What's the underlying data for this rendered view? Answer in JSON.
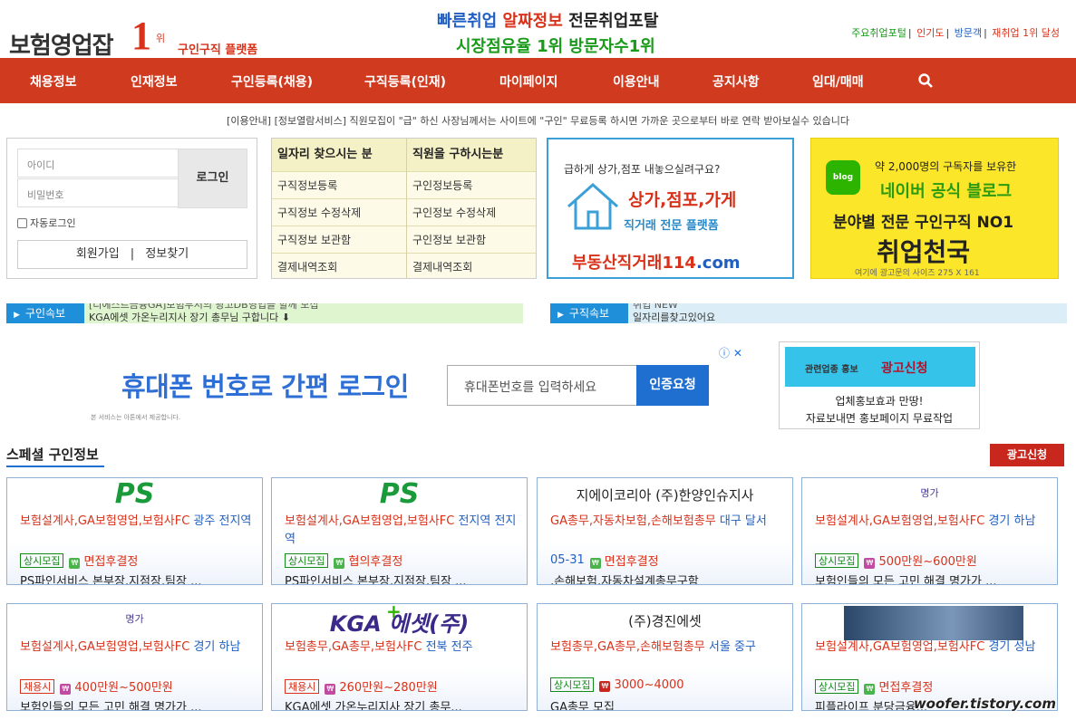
{
  "header": {
    "brand": "보험영업잡",
    "rank": "1",
    "rank_suffix": "위",
    "platform": "구인구직 플랫폼",
    "slogan_line1": [
      "빠른취업",
      "알짜정보",
      "전문취업포탈"
    ],
    "slogan_line2": "시장점유율 1위 방문자수1위",
    "top_links": [
      "주요취업포털",
      "인기도",
      "방문객",
      "재취업 1위 달성"
    ]
  },
  "nav": {
    "items": [
      "채용정보",
      "인재정보",
      "구인등록(채용)",
      "구직등록(인재)",
      "마이페이지",
      "이용안내",
      "공지사항",
      "임대/매매"
    ],
    "search_icon": "search-icon"
  },
  "notice": "[이용안내] [정보열람서비스] 직원모집이 \"급\" 하신 사장님께서는 사이트에 \"구인\" 무료등록 하시면 가까운 곳으로부터 바로 연락 받아보실수 있습니다",
  "login": {
    "id_placeholder": "아이디",
    "pw_placeholder": "비밀번호",
    "login_button": "로그인",
    "auto_login": "자동로그인",
    "join": "회원가입",
    "separator": "|",
    "find": "정보찾기"
  },
  "menu_table": {
    "headers": [
      "일자리 찾으시는 분",
      "직원을 구하시는분"
    ],
    "left": [
      "구직정보등록",
      "구직정보 수정삭제",
      "구직정보 보관함",
      "결제내역조회"
    ],
    "right": [
      "구인정보등록",
      "구인정보 수정삭제",
      "구인정보 보관함",
      "결제내역조회"
    ]
  },
  "realty_banner": {
    "question": "급하게 상가,점포 내놓으실려구요?",
    "headline": "상가,점포,가게",
    "sub": "직거래 전문 플랫폼",
    "url_main": "부동산직거래114",
    "url_tld": ".com"
  },
  "blog_banner": {
    "icon_text": "blog",
    "line1": "약 2,000명의 구독자를 보유한",
    "line2": "네이버 공식 블로그",
    "line3": "분야별 전문 구인구직 NO1",
    "line4": "취업천국",
    "line5": "여기에 광고문의 사이즈 275 X 161"
  },
  "tickers": [
    {
      "label": "구인속보",
      "lines": [
        "[디에스트금융GA]보험부서의 광고DB영업을 할께 모집",
        "KGA에셋 가온누리지사 장기 총무님 구합니다 ⬇"
      ]
    },
    {
      "label": "구직속보",
      "lines": [
        "취업 NEW",
        "일자리를찾고있어요"
      ]
    }
  ],
  "phone_login": {
    "title": "휴대폰 번호로 간편 로그인",
    "input_placeholder": "휴대폰번호를 입력하세요",
    "button": "인증요청",
    "note": "본 서비스는 아톤에서 제공합니다.",
    "close": "ⓘ ✕"
  },
  "small_ad": {
    "head_a": "관련업종 홍보",
    "head_b": "광고신청",
    "row1": "업체홍보효과 만땅!",
    "row2": "자료보내면 홍보페이지 무료작업"
  },
  "special": {
    "title": "스페셜 구인정보",
    "ad_apply": "광고신청",
    "cards": [
      {
        "logo": "PS",
        "desc": "보험설계사,GA보험영업,보험사FC",
        "loc": "광주 전지역",
        "badge": "상시모집",
        "badge_color": "g",
        "pay_icon": "pi-g",
        "pay": "면접후결정",
        "date": "",
        "body": "PS파인서비스 본부장,지점장,팀장 ..."
      },
      {
        "logo": "PS",
        "desc": "보험설계사,GA보험영업,보험사FC",
        "loc": "전지역 전지역",
        "badge": "상시모집",
        "badge_color": "g",
        "pay_icon": "pi-g",
        "pay": "협의후결정",
        "date": "",
        "body": "PS파인서비스 본부장,지점장,팀장 ..."
      },
      {
        "logo": "지에이코리아 (주)한양인슈지사",
        "desc": "GA총무,자동차보험,손해보험총무",
        "loc": "대구 달서",
        "badge": "",
        "badge_color": "g",
        "pay_icon": "pi-g",
        "pay": "면접후결정",
        "date": "05-31",
        "body": ",손해보험,자동차설계총무구함"
      },
      {
        "logo": "명가",
        "desc": "보험설계사,GA보험영업,보험사FC",
        "loc": "경기 하남",
        "badge": "상시모집",
        "badge_color": "g",
        "pay_icon": "pi-p",
        "pay": "500만원~600만원",
        "date": "",
        "body": "보험인들의 모든 고민 해결 명가가 ..."
      },
      {
        "logo": "명가",
        "desc": "보험설계사,GA보험영업,보험사FC",
        "loc": "경기 하남",
        "badge": "채용시",
        "badge_color": "r",
        "pay_icon": "pi-p",
        "pay": "400만원~500만원",
        "date": "",
        "body": "보험인들의 모든 고민 해결 명가가 ..."
      },
      {
        "logo": "KGA 에셋(주)",
        "desc": "보험총무,GA총무,보험사FC",
        "loc": "전북 전주",
        "badge": "채용시",
        "badge_color": "r",
        "pay_icon": "pi-p",
        "pay": "260만원~280만원",
        "date": "",
        "body": "KGA에셋 가온누리지사 장기 총무..."
      },
      {
        "logo": "(주)경진에셋",
        "desc": "보험총무,GA총무,손해보험총무",
        "loc": "서울 중구",
        "badge": "상시모집",
        "badge_color": "g",
        "pay_icon": "pi-r",
        "pay": "3000~4000",
        "date": "",
        "body": "GA총무 모집"
      },
      {
        "logo": "",
        "desc": "보험설계사,GA보험영업,보험사FC",
        "loc": "경기 성남",
        "badge": "상시모집",
        "badge_color": "g",
        "pay_icon": "pi-g",
        "pay": "면접후결정",
        "date": "",
        "body": "피플라이프 분당금융..."
      }
    ]
  },
  "watermark": "woofer.tistory.com",
  "colors": {
    "nav": "#d03a1f",
    "accent_blue": "#1f6fd0",
    "accent_red": "#d8321a",
    "ticker": "#1f8fd9"
  }
}
